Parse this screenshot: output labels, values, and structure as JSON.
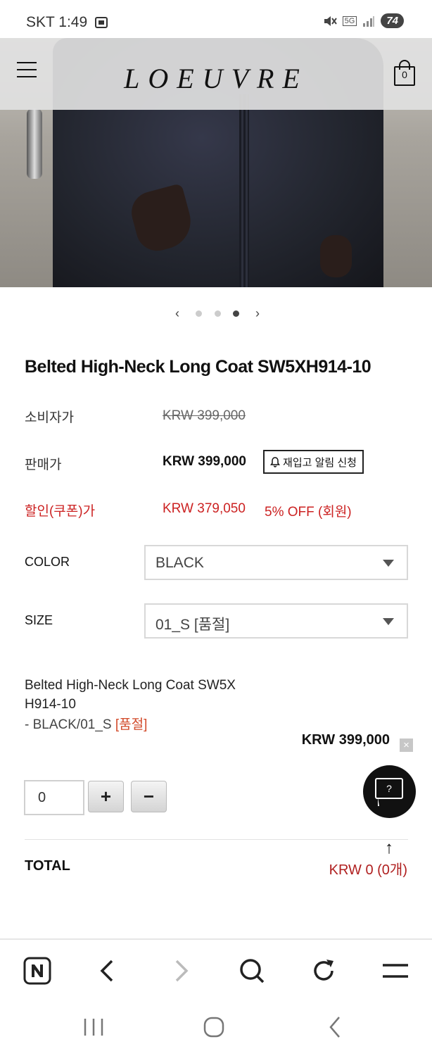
{
  "status_bar": {
    "carrier_time": "SKT 1:49",
    "battery": "74",
    "network": "5G"
  },
  "header": {
    "logo": "LOEUVRE",
    "cart_count": "0"
  },
  "carousel": {
    "prev": "‹",
    "next": "›",
    "dot_count": 3,
    "active_dot": 3
  },
  "product": {
    "title": "Belted High-Neck Long Coat SW5XH914-10",
    "consumer_price_label": "소비자가",
    "consumer_price": "KRW 399,000",
    "sale_price_label": "판매가",
    "sale_price": "KRW 399,000",
    "restock_button": "재입고 알림 신청",
    "coupon_price_label": "할인(쿠폰)가",
    "coupon_price": "KRW 379,050",
    "coupon_discount": "5% OFF (회원)"
  },
  "options": {
    "color_label": "COLOR",
    "color_value": "BLACK",
    "size_label": "SIZE",
    "size_value": "01_S [품절]"
  },
  "selected_item": {
    "name": "Belted High-Neck Long Coat SW5X H914-10",
    "option_prefix": "- BLACK/01_S ",
    "option_status": "[품절]",
    "price": "KRW 399,000",
    "remove": "×",
    "quantity": "0",
    "plus": "+",
    "minus": "−"
  },
  "chat": {
    "icon": "?"
  },
  "scroll_top": {
    "icon": "↑"
  },
  "total": {
    "label": "TOTAL",
    "value": "KRW 0 (0개)"
  },
  "colors": {
    "accent_red": "#cc2222",
    "text_dark": "#111111"
  }
}
